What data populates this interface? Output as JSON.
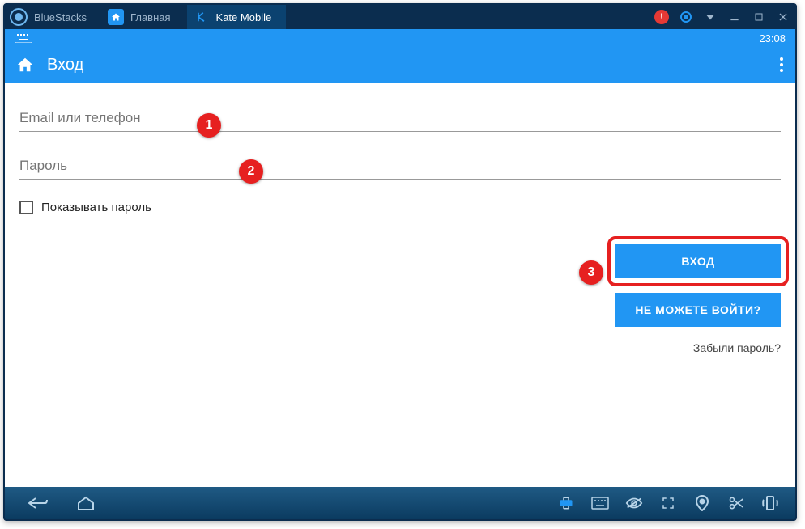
{
  "titlebar": {
    "app_name": "BlueStacks",
    "tabs": [
      {
        "label": "Главная"
      },
      {
        "label": "Kate Mobile"
      }
    ]
  },
  "status": {
    "time": "23:08"
  },
  "header": {
    "title": "Вход"
  },
  "form": {
    "email_placeholder": "Email или телефон",
    "password_placeholder": "Пароль",
    "show_password_label": "Показывать пароль",
    "login_button": "ВХОД",
    "cant_login_button": "НЕ МОЖЕТЕ ВОЙТИ?",
    "forgot_link": "Забыли пароль?"
  },
  "markers": {
    "m1": "1",
    "m2": "2",
    "m3": "3"
  },
  "colors": {
    "accent": "#2196f3",
    "marker": "#e62020",
    "frame": "#0b2d4f"
  }
}
